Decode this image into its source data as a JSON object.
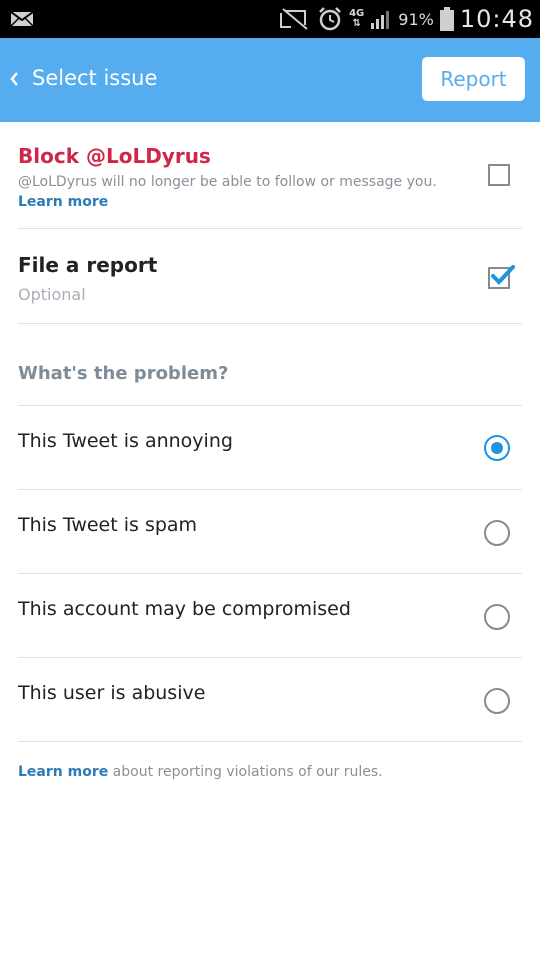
{
  "status_bar": {
    "network": "4G",
    "battery": "91%",
    "time": "10:48"
  },
  "header": {
    "title": "Select issue",
    "report_button": "Report"
  },
  "block": {
    "title": "Block @LoLDyrus",
    "description": "@LoLDyrus will no longer be able to follow or message you.",
    "learn_more": "Learn more",
    "checked": false
  },
  "file_report": {
    "title": "File a report",
    "subtitle": "Optional",
    "checked": true
  },
  "problem": {
    "heading": "What's the problem?",
    "options": [
      {
        "label": "This Tweet is annoying",
        "selected": true
      },
      {
        "label": "This Tweet is spam",
        "selected": false
      },
      {
        "label": "This account may be compromised",
        "selected": false
      },
      {
        "label": "This user is abusive",
        "selected": false
      }
    ]
  },
  "footer": {
    "learn_more": "Learn more",
    "text": " about reporting violations of our rules."
  },
  "colors": {
    "header": "#55acee",
    "accent": "#1b95e0",
    "block_red": "#d0264a",
    "link": "#2b7bb9"
  }
}
